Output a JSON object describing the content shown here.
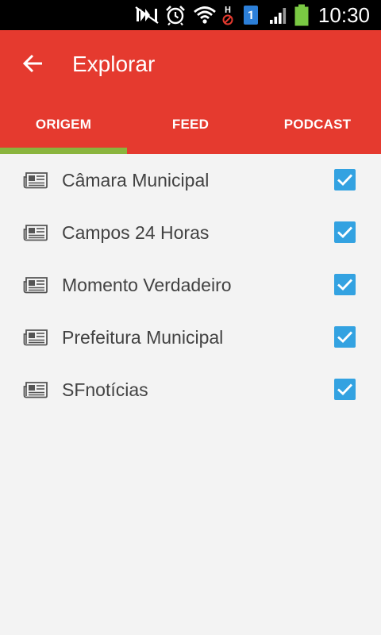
{
  "status_bar": {
    "time": "10:30",
    "sim_slot": "1",
    "network_type": "H",
    "icons": [
      "mute-icon",
      "alarm-icon",
      "wifi-icon",
      "no-data-icon",
      "sim-icon",
      "signal-icon",
      "battery-icon"
    ]
  },
  "app_bar": {
    "title": "Explorar",
    "back_icon": "arrow-left-icon"
  },
  "tabs": [
    {
      "label": "ORIGEM",
      "active": true
    },
    {
      "label": "FEED",
      "active": false
    },
    {
      "label": "PODCAST",
      "active": false
    }
  ],
  "sources": [
    {
      "label": "Câmara Municipal",
      "checked": true,
      "icon": "newspaper-icon"
    },
    {
      "label": "Campos 24 Horas",
      "checked": true,
      "icon": "newspaper-icon"
    },
    {
      "label": "Momento Verdadeiro",
      "checked": true,
      "icon": "newspaper-icon"
    },
    {
      "label": "Prefeitura Municipal",
      "checked": true,
      "icon": "newspaper-icon"
    },
    {
      "label": "SFnotícias",
      "checked": true,
      "icon": "newspaper-icon"
    }
  ],
  "colors": {
    "app_bar": "#e53a2f",
    "tab_indicator": "#8ab43d",
    "checkbox": "#33a2e1",
    "background": "#f3f3f3",
    "text": "#424242"
  }
}
